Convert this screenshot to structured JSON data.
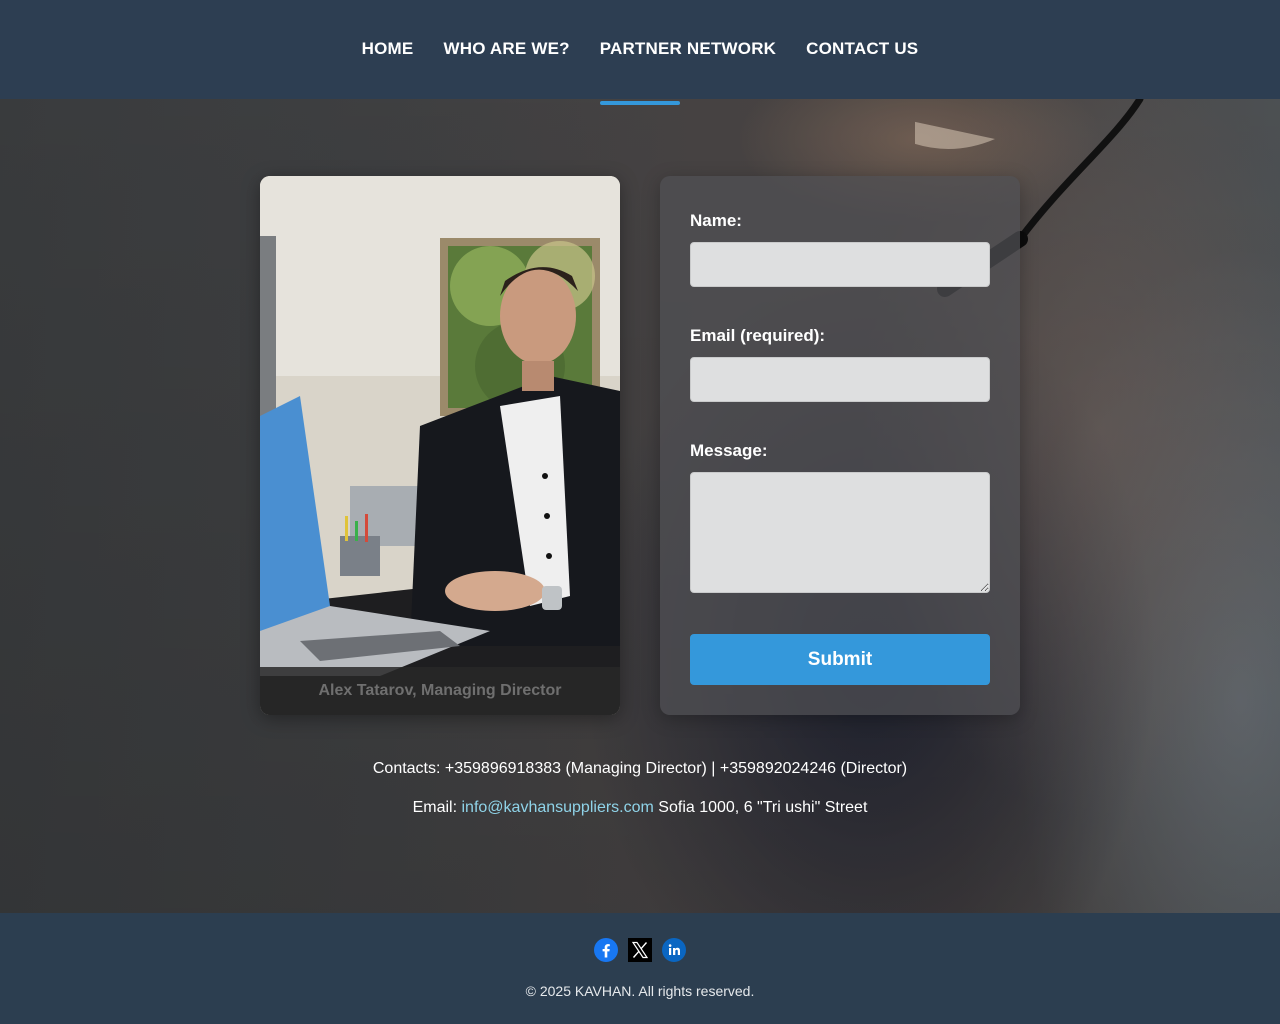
{
  "nav": {
    "items": [
      {
        "label": "HOME"
      },
      {
        "label": "WHO ARE WE?"
      },
      {
        "label": "PARTNER NETWORK"
      },
      {
        "label": "CONTACT US"
      }
    ],
    "active_index": 3,
    "accent_color": "#3498db"
  },
  "photo": {
    "caption": "Alex Tatarov, Managing Director"
  },
  "form": {
    "name_label": "Name:",
    "name_value": "",
    "email_label": "Email (required):",
    "email_value": "",
    "message_label": "Message:",
    "message_value": "",
    "submit_label": "Submit",
    "submit_color": "#3498db"
  },
  "contacts": {
    "phones_text": "Contacts: +359896918383 (Managing Director) | +359892024246 (Director)",
    "email_prefix": "Email:",
    "email_address": "info@kavhansuppliers.com",
    "address": "Sofia 1000, 6 \"Tri ushi\" Street"
  },
  "footer": {
    "social": [
      {
        "icon": "facebook-icon"
      },
      {
        "icon": "x-twitter-icon"
      },
      {
        "icon": "linkedin-icon"
      }
    ],
    "copyright": "© 2025 KAVHAN. All rights reserved."
  },
  "colors": {
    "header_bg": "#2d3e52",
    "footer_bg": "#2c3e50",
    "link_color": "#8fd3e8"
  }
}
